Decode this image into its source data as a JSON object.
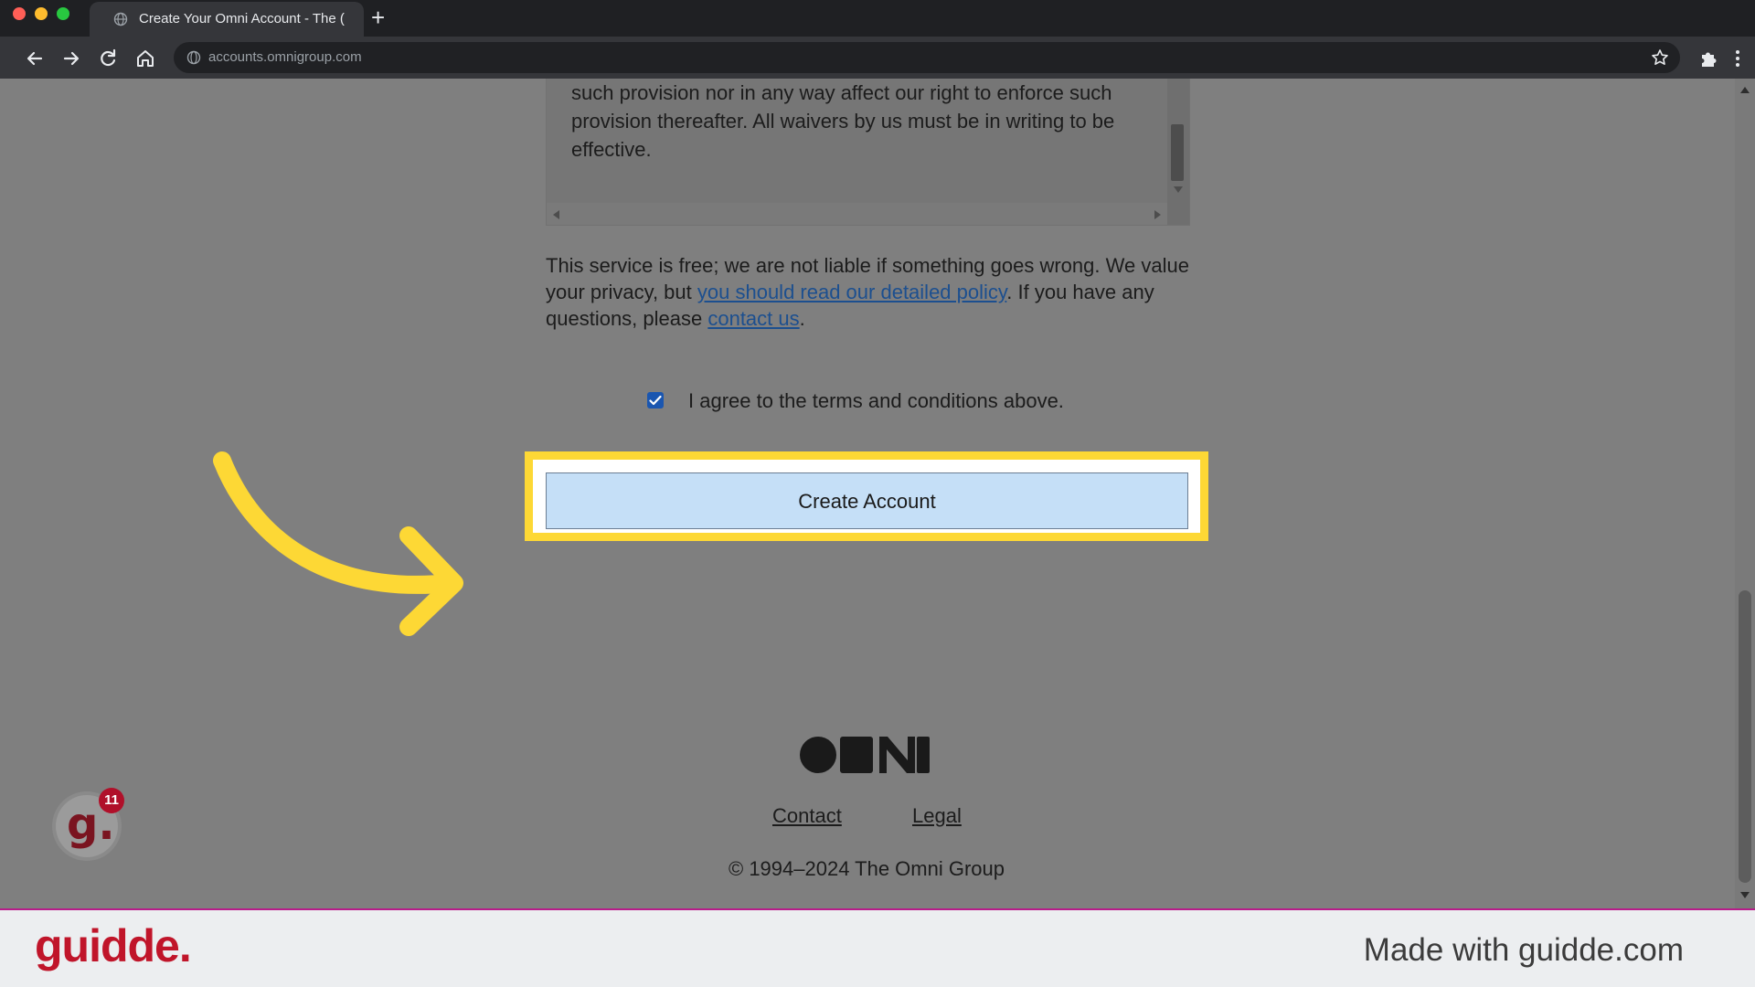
{
  "browser": {
    "tab_title": "Create Your Omni Account - The (",
    "new_tab": "+",
    "url": "accounts.omnigroup.com",
    "traffic_colors": [
      "#ff5f57",
      "#febc2e",
      "#28c840"
    ]
  },
  "terms_box": {
    "text": "such provision nor in any way affect our right to enforce such provision thereafter. All waivers by us must be in writing to be effective."
  },
  "notice": {
    "text_1": "This service is free; we are not liable if something goes wrong. We value your privacy, but ",
    "policy_link": "you should read our detailed policy",
    "text_2": ". If you have any questions, please ",
    "contact_link": "contact us",
    "text_3": "."
  },
  "agreement": {
    "label": "I agree to the terms and conditions above.",
    "checked": true
  },
  "create_button": {
    "label": "Create Account"
  },
  "footer": {
    "contact": "Contact",
    "legal": "Legal",
    "copyright": "© 1994–2024 The Omni Group"
  },
  "guidde": {
    "logo": "guidde.",
    "made_with": "Made with guidde.com",
    "badge_letter": "g.",
    "badge_count": "11"
  },
  "colors": {
    "highlight": "#fdd835",
    "arrow": "#fdd835",
    "button_bg": "#c5dff7",
    "brand_red": "#c0152a"
  }
}
